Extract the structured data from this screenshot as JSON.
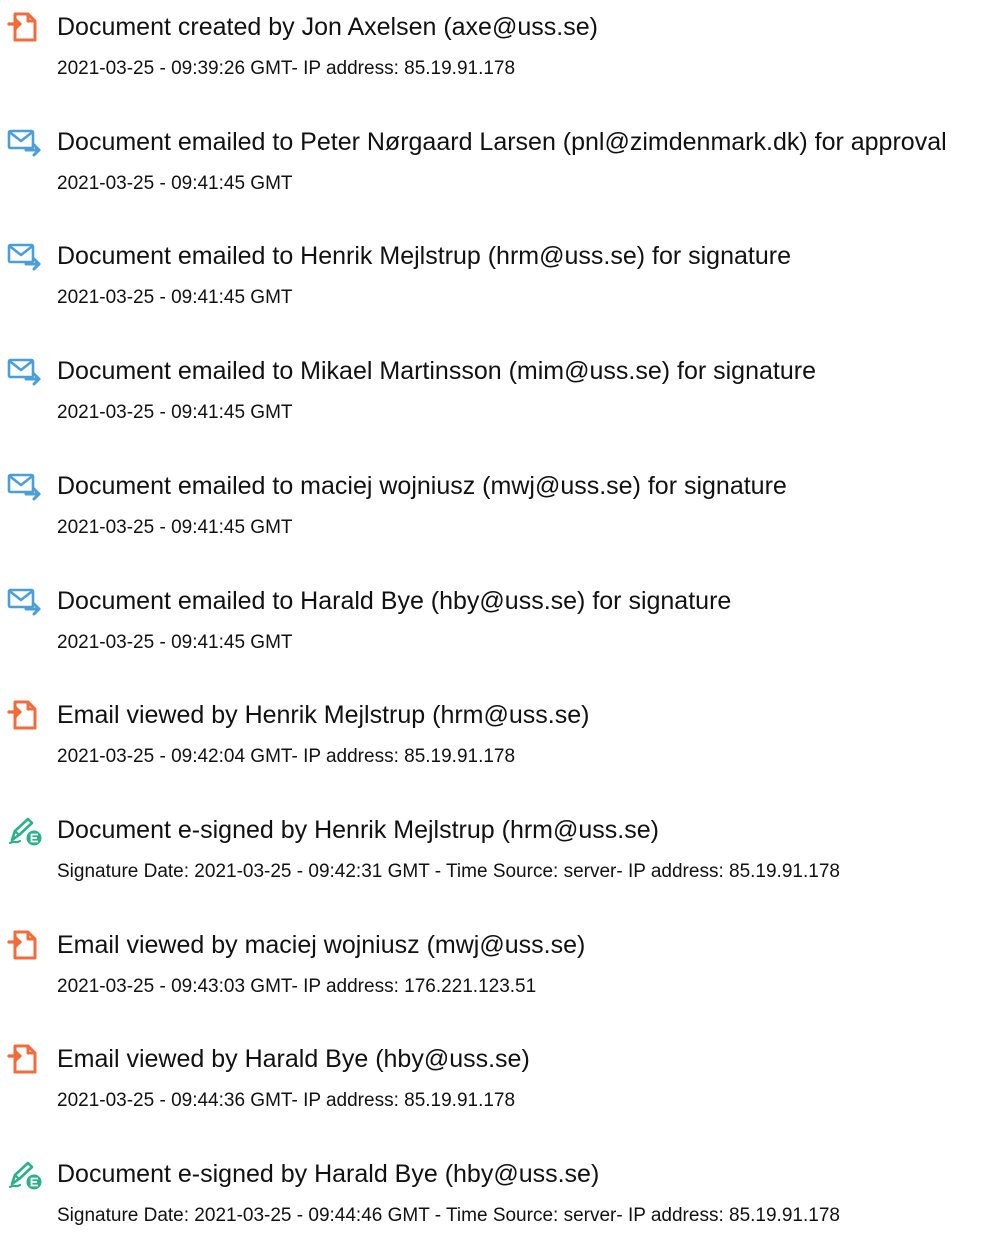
{
  "colors": {
    "doc_icon": "#f26b3a",
    "mail_icon": "#4a9fd8",
    "sign_icon": "#2bb08a",
    "text": "#111111"
  },
  "events": [
    {
      "icon": "document-icon",
      "title": "Document created by Jon Axelsen (axe@uss.se)",
      "detail": "2021-03-25 - 09:39:26 GMT- IP address: 85.19.91.178"
    },
    {
      "icon": "email-sent-icon",
      "title": "Document emailed to Peter Nørgaard Larsen (pnl@zimdenmark.dk) for approval",
      "detail": "2021-03-25 - 09:41:45 GMT"
    },
    {
      "icon": "email-sent-icon",
      "title": "Document emailed to Henrik Mejlstrup (hrm@uss.se) for signature",
      "detail": "2021-03-25 - 09:41:45 GMT"
    },
    {
      "icon": "email-sent-icon",
      "title": "Document emailed to Mikael Martinsson (mim@uss.se) for signature",
      "detail": "2021-03-25 - 09:41:45 GMT"
    },
    {
      "icon": "email-sent-icon",
      "title": "Document emailed to maciej wojniusz (mwj@uss.se) for signature",
      "detail": "2021-03-25 - 09:41:45 GMT"
    },
    {
      "icon": "email-sent-icon",
      "title": "Document emailed to Harald Bye (hby@uss.se) for signature",
      "detail": "2021-03-25 - 09:41:45 GMT"
    },
    {
      "icon": "document-icon",
      "title": "Email viewed by Henrik Mejlstrup (hrm@uss.se)",
      "detail": "2021-03-25 - 09:42:04 GMT- IP address: 85.19.91.178"
    },
    {
      "icon": "e-sign-icon",
      "title": "Document e-signed by Henrik Mejlstrup (hrm@uss.se)",
      "detail": "Signature Date: 2021-03-25 - 09:42:31 GMT - Time Source: server- IP address: 85.19.91.178"
    },
    {
      "icon": "document-icon",
      "title": "Email viewed by maciej wojniusz (mwj@uss.se)",
      "detail": "2021-03-25 - 09:43:03 GMT- IP address: 176.221.123.51"
    },
    {
      "icon": "document-icon",
      "title": "Email viewed by Harald Bye (hby@uss.se)",
      "detail": "2021-03-25 - 09:44:36 GMT- IP address: 85.19.91.178"
    },
    {
      "icon": "e-sign-icon",
      "title": "Document e-signed by Harald Bye (hby@uss.se)",
      "detail": "Signature Date: 2021-03-25 - 09:44:46 GMT - Time Source: server- IP address: 85.19.91.178"
    }
  ]
}
